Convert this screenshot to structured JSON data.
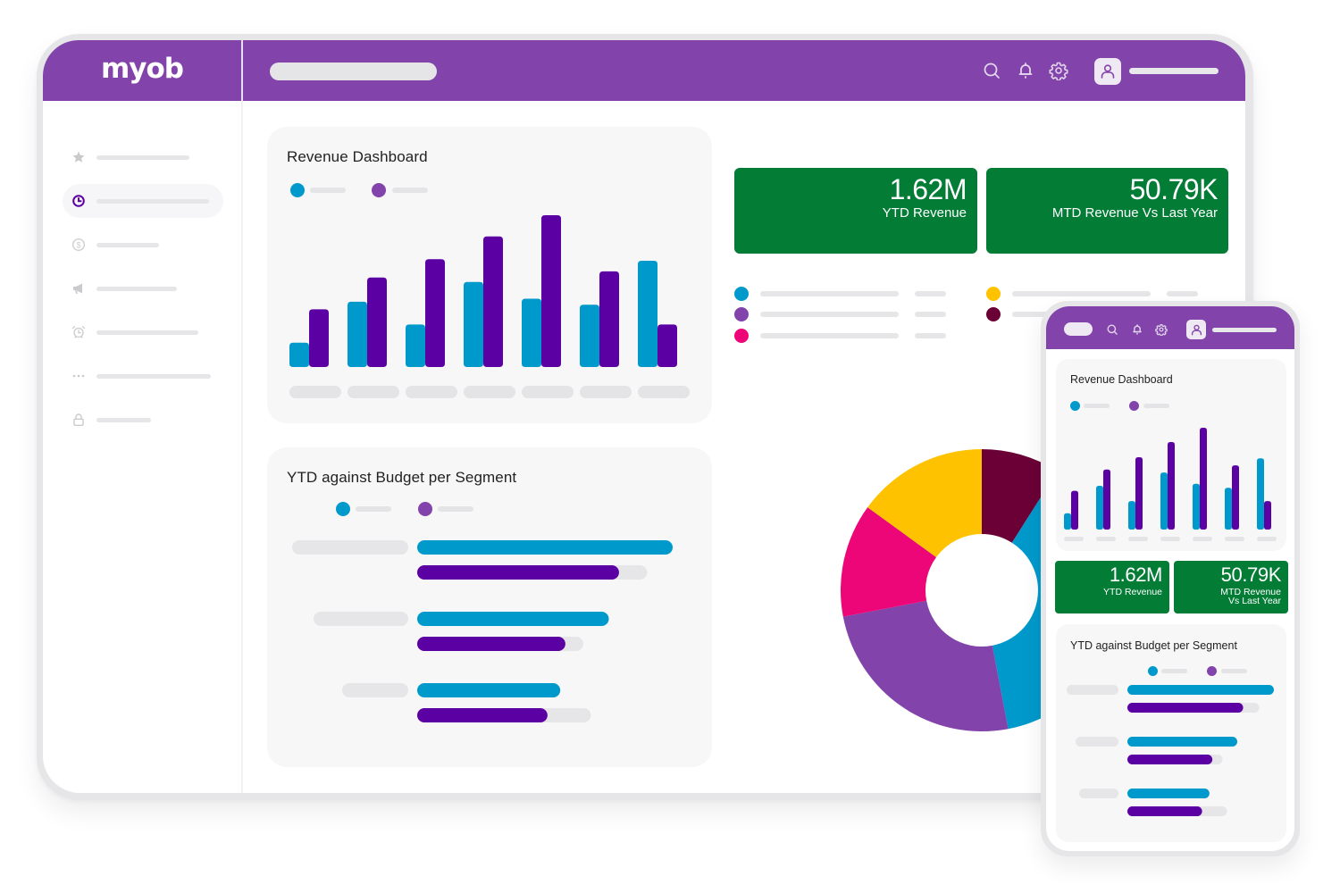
{
  "app": {
    "brand": "myob",
    "colors": {
      "brand_purple": "#8243ab",
      "series_primary": "#0099cc",
      "series_secondary": "#5b00a3",
      "kpi_green": "#037c36",
      "placeholder_gray": "#e4e4e6"
    }
  },
  "topbar": {
    "search_placeholder": "",
    "icons": [
      "search-icon",
      "bell-icon",
      "gear-icon",
      "user-avatar-icon"
    ],
    "username": ""
  },
  "sidebar": {
    "items": [
      {
        "icon": "star-icon",
        "label": "",
        "active": false
      },
      {
        "icon": "clock-icon",
        "label": "",
        "active": true
      },
      {
        "icon": "dollar-icon",
        "label": "",
        "active": false
      },
      {
        "icon": "megaphone-icon",
        "label": "",
        "active": false
      },
      {
        "icon": "alarm-clock-icon",
        "label": "",
        "active": false
      },
      {
        "icon": "more-dots-icon",
        "label": "",
        "active": false
      },
      {
        "icon": "lock-icon",
        "label": "",
        "active": false
      }
    ]
  },
  "revenue_card": {
    "title": "Revenue Dashboard",
    "legend": [
      {
        "color": "#0099cc",
        "label": ""
      },
      {
        "color": "#8243ab",
        "label": ""
      }
    ]
  },
  "segment_card": {
    "title": "YTD against Budget per Segment",
    "legend": [
      {
        "color": "#0099cc",
        "label": ""
      },
      {
        "color": "#8243ab",
        "label": ""
      }
    ]
  },
  "kpis": [
    {
      "value": "1.62M",
      "label": "YTD Revenue"
    },
    {
      "value": "50.79K",
      "label": "MTD Revenue Vs Last Year"
    }
  ],
  "mobile": {
    "kpis": [
      {
        "value": "1.62M",
        "label_lines": [
          "YTD Revenue"
        ]
      },
      {
        "value": "50.79K",
        "label_lines": [
          "MTD Revenue",
          "Vs Last Year"
        ]
      }
    ],
    "revenue_title": "Revenue Dashboard",
    "segment_title": "YTD against Budget per Segment"
  },
  "chart_data": [
    {
      "id": "revenue_bars",
      "type": "bar",
      "title": "Revenue Dashboard",
      "categories": [
        "",
        "",
        "",
        "",
        "",
        "",
        ""
      ],
      "series": [
        {
          "name": "",
          "color": "#0099cc",
          "values": [
            16,
            43,
            28,
            56,
            45,
            41,
            70
          ]
        },
        {
          "name": "",
          "color": "#5b00a3",
          "values": [
            38,
            59,
            71,
            86,
            100,
            63,
            28
          ]
        }
      ],
      "ylim": [
        0,
        100
      ],
      "xlabel": "",
      "ylabel": "",
      "grid": false,
      "legend": "top-left"
    },
    {
      "id": "segment_bars",
      "type": "bar",
      "orientation": "horizontal",
      "title": "YTD against Budget per Segment",
      "categories": [
        "",
        "",
        ""
      ],
      "series": [
        {
          "name": "",
          "color": "#0099cc",
          "values": [
            100,
            75,
            56
          ]
        },
        {
          "name": "",
          "color": "#5b00a3",
          "values": [
            79,
            58,
            51
          ],
          "budget_track": [
            90,
            65,
            68
          ]
        }
      ],
      "xlim": [
        0,
        100
      ],
      "grid": false,
      "legend": "top"
    },
    {
      "id": "segment_donut",
      "type": "pie",
      "donut": true,
      "labels": [
        "",
        "",
        "",
        "",
        ""
      ],
      "colors": [
        "#6b0036",
        "#0099cc",
        "#8243ab",
        "#ec0677",
        "#ffc200"
      ],
      "values": [
        9,
        38,
        25,
        13,
        15
      ],
      "legend": "top",
      "legend_values": [
        "",
        "",
        "",
        "",
        ""
      ]
    }
  ]
}
